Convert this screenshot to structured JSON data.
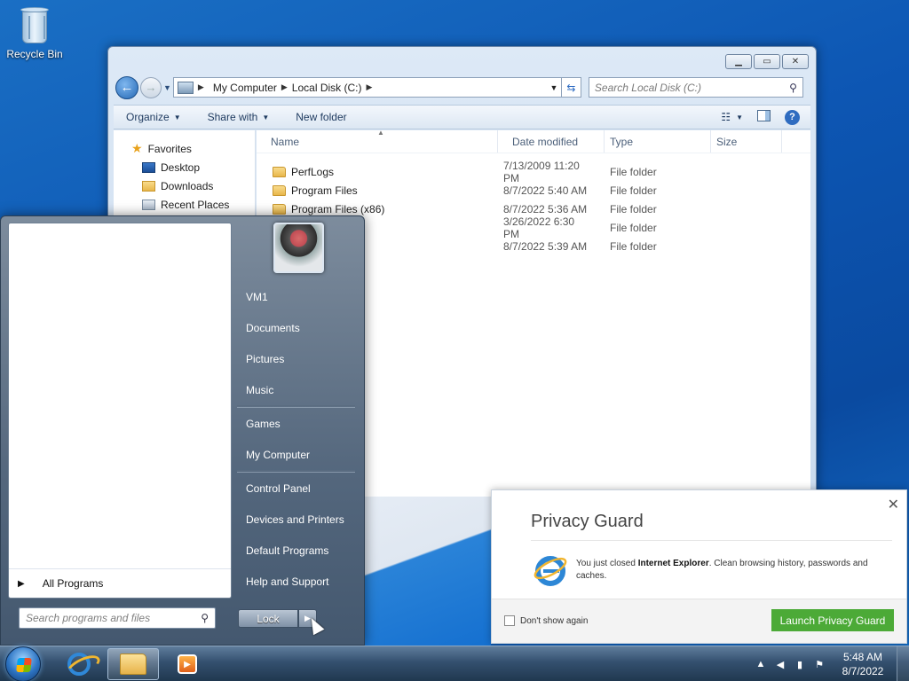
{
  "desktop": {
    "recycle_bin": "Recycle Bin"
  },
  "explorer": {
    "breadcrumb": [
      "My Computer",
      "Local Disk (C:)"
    ],
    "search_placeholder": "Search Local Disk (C:)",
    "toolbar": {
      "organize": "Organize",
      "share_with": "Share with",
      "new_folder": "New folder"
    },
    "nav": {
      "favorites": "Favorites",
      "items": [
        "Desktop",
        "Downloads",
        "Recent Places"
      ]
    },
    "columns": {
      "name": "Name",
      "date": "Date modified",
      "type": "Type",
      "size": "Size"
    },
    "rows": [
      {
        "name": "PerfLogs",
        "date": "7/13/2009 11:20 PM",
        "type": "File folder"
      },
      {
        "name": "Program Files",
        "date": "8/7/2022 5:40 AM",
        "type": "File folder"
      },
      {
        "name": "Program Files (x86)",
        "date": "8/7/2022 5:36 AM",
        "type": "File folder"
      },
      {
        "name": "",
        "date": "3/26/2022 6:30 PM",
        "type": "File folder"
      },
      {
        "name": "",
        "date": "8/7/2022 5:39 AM",
        "type": "File folder"
      }
    ]
  },
  "start_menu": {
    "all_programs": "All Programs",
    "search_placeholder": "Search programs and files",
    "right_links": {
      "group1": [
        "VM1",
        "Documents",
        "Pictures",
        "Music"
      ],
      "group2": [
        "Games",
        "My Computer"
      ],
      "group3": [
        "Control Panel",
        "Devices and Printers",
        "Default Programs",
        "Help and Support"
      ]
    },
    "lock_label": "Lock"
  },
  "privacy_guard": {
    "title": "Privacy Guard",
    "message_prefix": "You just closed ",
    "message_bold": "Internet Explorer",
    "message_suffix": ". Clean browsing history, passwords and caches.",
    "dont_show": "Don't show again",
    "launch": "Launch Privacy Guard"
  },
  "taskbar": {
    "time": "5:48 AM",
    "date": "8/7/2022"
  },
  "colors": {
    "launch_button": "#4caa37",
    "desktop": "#0d56b3"
  }
}
